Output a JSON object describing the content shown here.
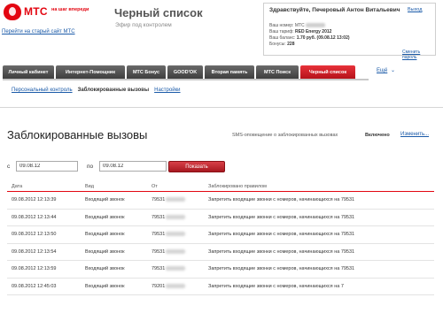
{
  "header": {
    "logo_text": "МТС",
    "slogan": "на шаг впереди",
    "title": "Черный список",
    "subtitle": "Эфир под контролем",
    "old_version_link": "Перейти на старый сайт МТС"
  },
  "account": {
    "greeting": "Здравствуйте, Печеровый Антон Витальевич",
    "exit_label": "Выход",
    "line_number_label": "Ваш номер: МТС",
    "line_tariff_label": "Ваш тариф:",
    "line_tariff_value": "RED Energy 2012",
    "line_balance_label": "Ваш баланс:",
    "line_balance_value": "1.70 руб. (09.08.12 13:02)",
    "line_bonus_label": "Бонусы:",
    "line_bonus_value": "228",
    "change_password": "Сменить пароль"
  },
  "nav": {
    "tabs": [
      {
        "label": "Личный кабинет",
        "active": false
      },
      {
        "label": "Интернет-Помощник",
        "active": false
      },
      {
        "label": "МТС Бонус",
        "active": false
      },
      {
        "label": "GOOD'OK",
        "active": false
      },
      {
        "label": "Вторая память",
        "active": false
      },
      {
        "label": "МТС Поиск",
        "active": false
      },
      {
        "label": "Черный список",
        "active": true
      }
    ],
    "more_label": "Ещё",
    "more_arrow": "⌄"
  },
  "subnav": {
    "items": [
      {
        "label": "Персональный контроль",
        "current": false
      },
      {
        "label": "Заблокированные вызовы",
        "current": true
      },
      {
        "label": "Настройки",
        "current": false
      }
    ]
  },
  "section": {
    "title": "Заблокированные вызовы",
    "sms_label": "SMS-оповещение о заблокированных вызовах",
    "sms_status": "Включено",
    "sms_change": "Изменить..."
  },
  "filter": {
    "from_label": "с",
    "from_value": "09.08.12",
    "to_label": "по",
    "to_value": "09.08.12",
    "show_button": "Показать"
  },
  "table": {
    "headers": [
      "Дата",
      "Вид",
      "От",
      "Заблокировано правилом"
    ],
    "rows": [
      {
        "date": "09.08.2012 12:13:39",
        "type": "Входящий звонок",
        "from": "79531",
        "rule": "Запретить входящие звонки с номеров, начинающихся на 79531"
      },
      {
        "date": "09.08.2012 12:13:44",
        "type": "Входящий звонок",
        "from": "79531",
        "rule": "Запретить входящие звонки с номеров, начинающихся на 79531"
      },
      {
        "date": "09.08.2012 12:13:50",
        "type": "Входящий звонок",
        "from": "79531",
        "rule": "Запретить входящие звонки с номеров, начинающихся на 79531"
      },
      {
        "date": "09.08.2012 12:13:54",
        "type": "Входящий звонок",
        "from": "79531",
        "rule": "Запретить входящие звонки с номеров, начинающихся на 79531"
      },
      {
        "date": "09.08.2012 12:13:59",
        "type": "Входящий звонок",
        "from": "79531",
        "rule": "Запретить входящие звонки с номеров, начинающихся на 79531"
      },
      {
        "date": "09.08.2012 12:45:03",
        "type": "Входящий звонок",
        "from": "79201",
        "rule": "Запретить входящие звонки с номеров, начинающихся на 7"
      }
    ]
  },
  "colors": {
    "brand_red": "#e30611",
    "link_blue": "#1a5aa8",
    "nav_dark": "#4a4a4a"
  }
}
